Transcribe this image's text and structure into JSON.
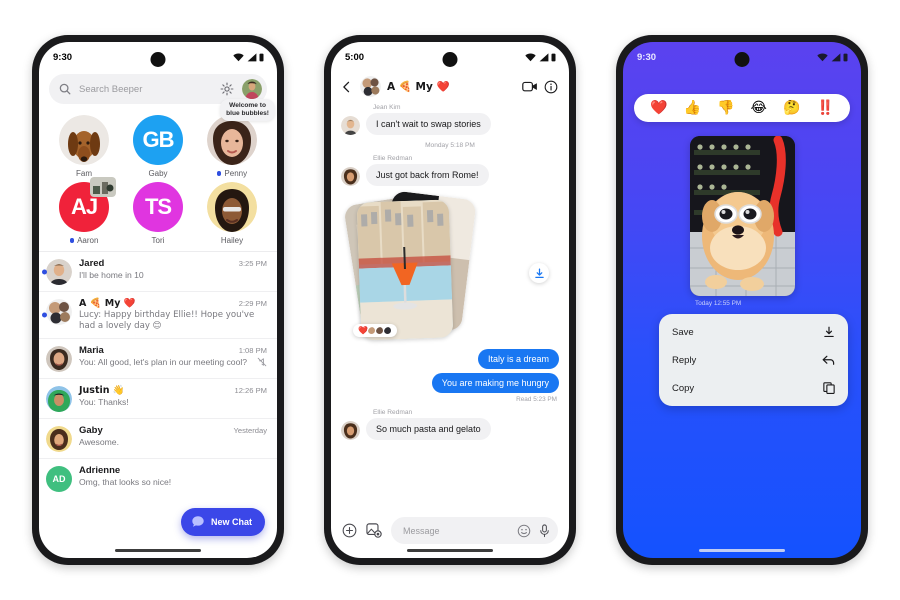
{
  "phones": {
    "inbox": {
      "status": {
        "time": "9:30",
        "icons": [
          "wifi-icon",
          "signal-icon",
          "battery-icon"
        ]
      },
      "search": {
        "placeholder": "Search Beeper",
        "icons": [
          "search-icon",
          "gear-icon",
          "profile-avatar"
        ]
      },
      "avatars": [
        {
          "label": "Fam",
          "type": "photo",
          "photo": "dog-portrait",
          "unread": false,
          "tooltip": null
        },
        {
          "label": "Gaby",
          "type": "initials",
          "initials": "GB",
          "color": "#1da1f2",
          "unread": false,
          "tooltip": null
        },
        {
          "label": "Penny",
          "type": "photo",
          "photo": "woman-portrait",
          "unread": true,
          "tooltip": "Welcome to\nblue bubbles!"
        },
        {
          "label": "Aaron",
          "type": "initials",
          "initials": "AJ",
          "color": "#f0223a",
          "unread": true,
          "tooltip": null
        },
        {
          "label": "Tori",
          "type": "initials",
          "initials": "TS",
          "color": "#e035e0",
          "unread": false,
          "tooltip": null
        },
        {
          "label": "Hailey",
          "type": "photo",
          "photo": "woman-sunglasses",
          "unread": false,
          "tooltip": null
        }
      ],
      "chats": [
        {
          "name": "Jared",
          "preview": "I'll be home in 10",
          "time": "3:25 PM",
          "unread": true,
          "muted": false,
          "avatar": "man-portrait"
        },
        {
          "name": "A 🍕 My ❤️",
          "preview": "Lucy: Happy birthday Ellie!! Hope you've had a lovely day  😊",
          "time": "2:29 PM",
          "unread": true,
          "muted": false,
          "avatar": "group-avatar"
        },
        {
          "name": "Maria",
          "preview": "You: All good, let's plan in our meeting cool?",
          "time": "1:08 PM",
          "unread": false,
          "muted": true,
          "avatar": "woman-portrait"
        },
        {
          "name": "Justin 👋",
          "preview": "You: Thanks!",
          "time": "12:26 PM",
          "unread": false,
          "muted": false,
          "avatar": "man-green"
        },
        {
          "name": "Gaby",
          "preview": "Awesome.",
          "time": "Yesterday",
          "unread": false,
          "muted": false,
          "avatar": "woman-yellow"
        },
        {
          "name": "Adrienne",
          "preview": "Omg, that looks so nice!",
          "time": "",
          "unread": false,
          "muted": false,
          "avatar": "initials-AD"
        }
      ],
      "fab": {
        "label": "New Chat",
        "icon": "chat-bubble-icon"
      }
    },
    "conversation": {
      "status": {
        "time": "5:00"
      },
      "header": {
        "title": "A 🍕 My ❤️",
        "back_icon": "back-arrow-icon",
        "video_icon": "video-call-icon",
        "info_icon": "info-icon"
      },
      "messages": [
        {
          "kind": "incoming",
          "sender": "Jean Kim",
          "text": "I can't wait to swap stories"
        },
        {
          "kind": "daystamp",
          "text": "Monday 5:18 PM"
        },
        {
          "kind": "incoming",
          "sender": "Ellie Redman",
          "text": "Just got back from Rome!"
        },
        {
          "kind": "photos",
          "reaction": "❤️",
          "download_icon": "download-icon"
        },
        {
          "kind": "outgoing",
          "text": "Italy is a dream"
        },
        {
          "kind": "outgoing",
          "text": "You are making me hungry"
        },
        {
          "kind": "readstamp",
          "text": "Read  5:23 PM"
        },
        {
          "kind": "incoming",
          "sender": "Ellie Redman",
          "text": "So much pasta and gelato"
        }
      ],
      "composer": {
        "placeholder": "Message",
        "plus_icon": "plus-circle-icon",
        "gallery_icon": "gallery-icon",
        "emoji_icon": "emoji-icon",
        "mic_icon": "microphone-icon"
      }
    },
    "media": {
      "status": {
        "time": "9:30"
      },
      "reactions": [
        "❤️",
        "👍",
        "👎",
        "😂",
        "🤔",
        "‼️"
      ],
      "photo": "dog-with-sunglasses",
      "timestamp": "Today  12:55 PM",
      "menu": [
        {
          "label": "Save",
          "icon": "download-icon"
        },
        {
          "label": "Reply",
          "icon": "reply-arrow-icon"
        },
        {
          "label": "Copy",
          "icon": "copy-icon"
        }
      ]
    }
  },
  "colors": {
    "accent_blue": "#3b47e8",
    "bubble_blue": "#1977f2",
    "bubble_gray": "#f1f1f3",
    "unread_dot": "#2f4fe0",
    "bg": "#ffffff"
  }
}
